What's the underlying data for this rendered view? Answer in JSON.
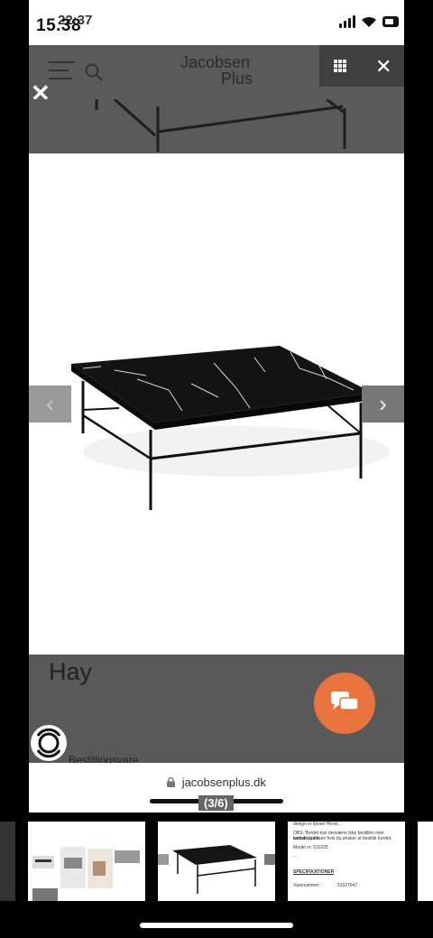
{
  "status": {
    "time": "15.38",
    "time_overlay": "22:37"
  },
  "header": {
    "logo_line1": "Jacobsen",
    "logo_line2": "Plus"
  },
  "product": {
    "brand": "Hay",
    "availability": "Bestillingsvare"
  },
  "gallery": {
    "counter": "(3/6)",
    "prev": "‹",
    "next": "›",
    "close": "✕"
  },
  "browser": {
    "url": "jacobsenplus.dk"
  },
  "thumbnail_text": {
    "line1": "design er tjosen Henvi...",
    "line2": "OBS: Bordet kan desværre ikke bestilles over webshoppen,",
    "line3": "kontakt butikken hvis du ønsker at bestille bordet.",
    "model": "Model nr: 510225",
    "more": "...",
    "specs": "SPECIFIKATIONER",
    "item_label": "Varenummer:",
    "item_value": "51027647"
  },
  "colors": {
    "overlay": "#595959",
    "chat": "#e8733f",
    "background": "#000000"
  },
  "icons": [
    "hamburger-icon",
    "search-icon",
    "grid-icon",
    "close-icon",
    "chevron-left-icon",
    "chevron-right-icon",
    "chat-icon",
    "lock-icon"
  ]
}
